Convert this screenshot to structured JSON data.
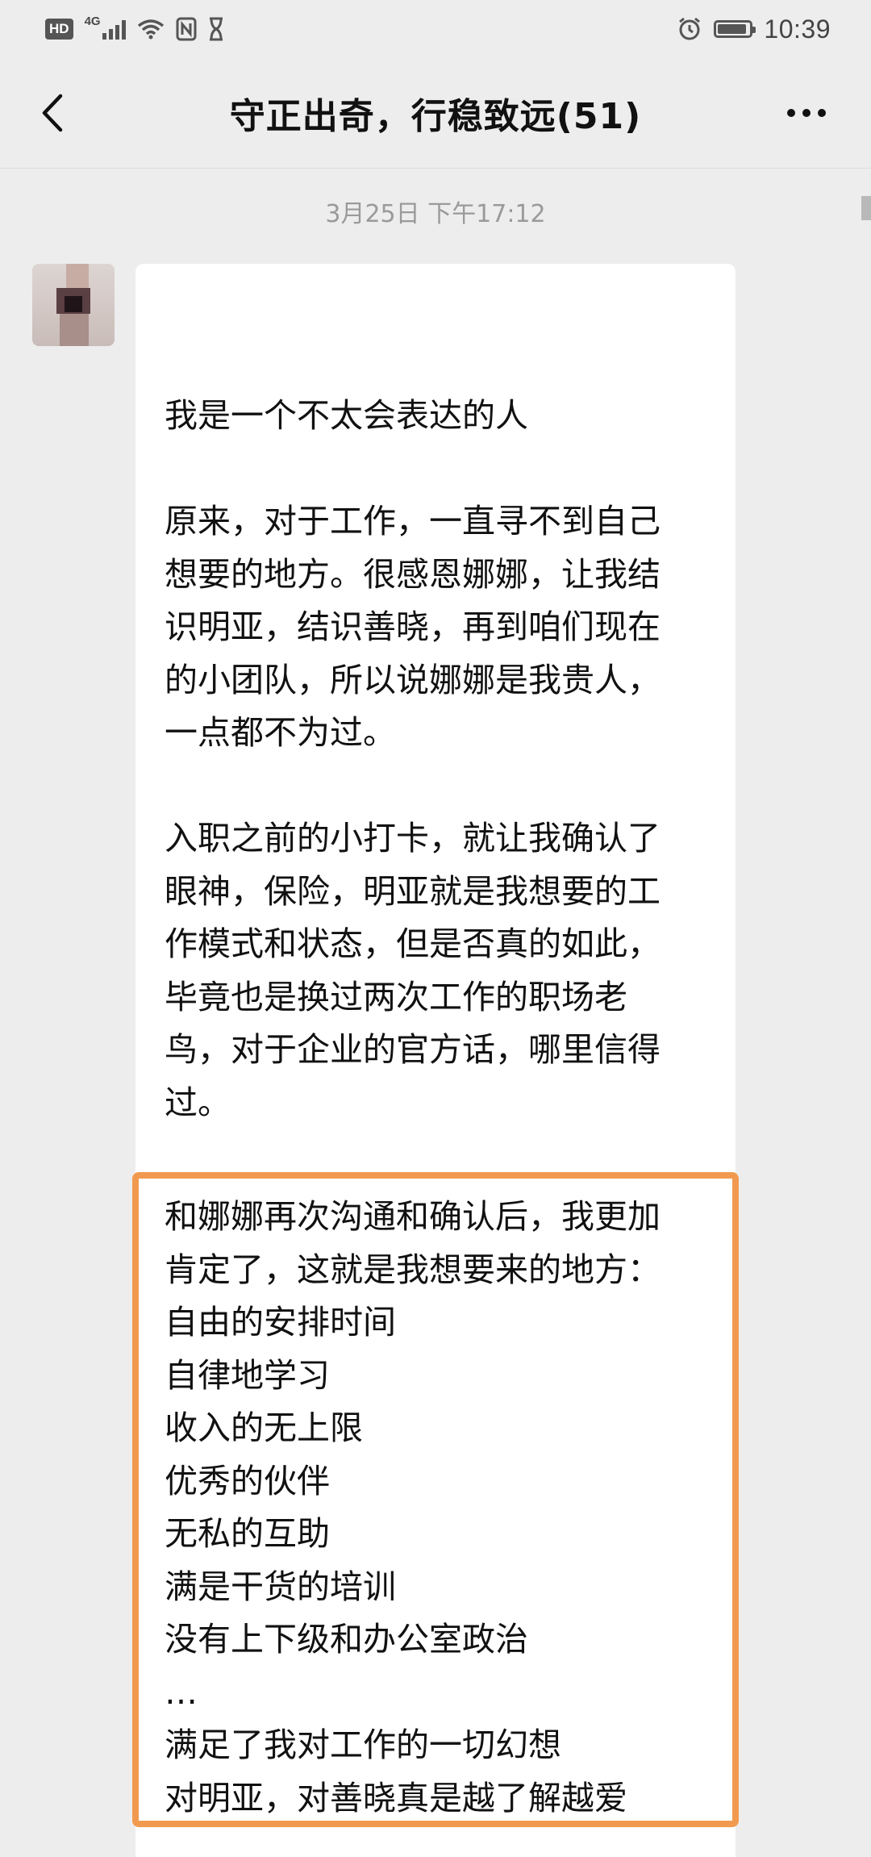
{
  "status_bar": {
    "hd": "HD",
    "network": "4G",
    "time": "10:39",
    "battery_level": 0.9
  },
  "nav": {
    "title": "守正出奇，行稳致远(51)"
  },
  "chat": {
    "timestamp": "3月25日 下午17:12",
    "message": {
      "block1": [
        "我是一个不太会表达的人"
      ],
      "block2": [
        "原来，对于工作，一直寻不到自己",
        "想要的地方。很感恩娜娜，让我结",
        "识明亚，结识善晓，再到咱们现在",
        "的小团队，所以说娜娜是我贵人，",
        "一点都不为过。"
      ],
      "block3": [
        "入职之前的小打卡，就让我确认了",
        "眼神，保险，明亚就是我想要的工",
        "作模式和状态，但是否真的如此，",
        "毕竟也是换过两次工作的职场老",
        "鸟，对于企业的官方话，哪里信得",
        "过。"
      ],
      "highlighted": [
        "和娜娜再次沟通和确认后，我更加",
        "肯定了，这就是我想要来的地方：",
        "自由的安排时间",
        "自律地学习",
        "收入的无上限",
        "优秀的伙伴",
        "无私的互助",
        "满是干货的培训",
        "没有上下级和办公室政治",
        "…",
        "满足了我对工作的一切幻想",
        "对明亚，对善晓真是越了解越爱"
      ]
    }
  },
  "colors": {
    "background": "#ededed",
    "bubble": "#ffffff",
    "highlight_border": "#f19a4f",
    "timestamp": "#9a9a9a"
  },
  "icons": {
    "back": "chevron-left-icon",
    "more": "more-dots-icon",
    "wifi": "wifi-icon",
    "nfc": "nfc-icon",
    "alarm": "alarm-icon",
    "battery": "battery-icon"
  }
}
